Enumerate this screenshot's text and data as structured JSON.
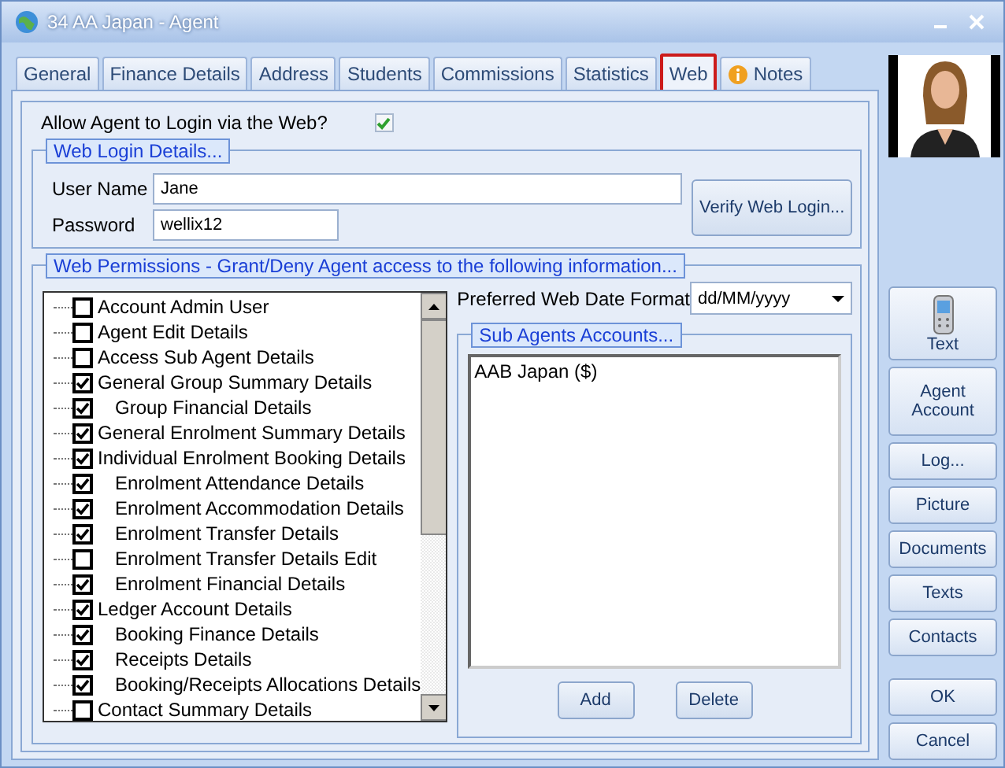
{
  "window": {
    "title": "34 AA Japan - Agent"
  },
  "tabs": [
    {
      "label": "General",
      "selected": false
    },
    {
      "label": "Finance Details",
      "selected": false
    },
    {
      "label": "Address",
      "selected": false
    },
    {
      "label": "Students",
      "selected": false
    },
    {
      "label": "Commissions",
      "selected": false
    },
    {
      "label": "Statistics",
      "selected": false
    },
    {
      "label": "Web",
      "selected": true
    },
    {
      "label": "Notes",
      "selected": false,
      "kind": "info"
    }
  ],
  "allow_web_login": {
    "label": "Allow Agent to Login via the Web?",
    "checked": true
  },
  "web_login": {
    "title": "Web Login Details...",
    "user_name_label": "User Name",
    "user_name": "Jane",
    "password_label": "Password",
    "password": "wellix12",
    "verify_button": "Verify Web Login..."
  },
  "permissions_title": "Web Permissions - Grant/Deny Agent access to the following information...",
  "permissions": [
    {
      "label": "Account Admin User",
      "checked": false
    },
    {
      "label": "Agent Edit Details",
      "checked": false
    },
    {
      "label": "Access Sub Agent Details",
      "checked": false
    },
    {
      "label": "General Group Summary Details",
      "checked": true,
      "children": [
        {
          "label": "Group Financial Details",
          "checked": true
        }
      ]
    },
    {
      "label": "General Enrolment Summary Details",
      "checked": true
    },
    {
      "label": "Individual Enrolment Booking Details",
      "checked": true,
      "children": [
        {
          "label": "Enrolment Attendance Details",
          "checked": true
        },
        {
          "label": "Enrolment Accommodation Details",
          "checked": true
        },
        {
          "label": "Enrolment Transfer Details",
          "checked": true
        },
        {
          "label": "Enrolment Transfer Details Edit",
          "checked": false
        },
        {
          "label": "Enrolment Financial Details",
          "checked": true
        }
      ]
    },
    {
      "label": "Ledger Account Details",
      "checked": true,
      "children": [
        {
          "label": "Booking Finance Details",
          "checked": true
        },
        {
          "label": "Receipts Details",
          "checked": true
        },
        {
          "label": "Booking/Receipts Allocations Details",
          "checked": true
        }
      ]
    },
    {
      "label": "Contact Summary Details",
      "checked": false
    }
  ],
  "date_format": {
    "label": "Preferred Web Date Format",
    "value": "dd/MM/yyyy"
  },
  "sub_agents": {
    "title": "Sub Agents Accounts...",
    "items": [
      "AAB Japan ($)"
    ],
    "buttons": [
      "Add",
      "Delete"
    ]
  },
  "side_buttons": [
    {
      "label": "Text",
      "kind": "phone"
    },
    {
      "label": "Agent Account",
      "kind": "plain"
    },
    {
      "label": "Log...",
      "kind": "plain"
    },
    {
      "label": "Picture",
      "kind": "plain"
    },
    {
      "label": "Documents",
      "kind": "plain"
    },
    {
      "label": "Texts",
      "kind": "plain"
    },
    {
      "label": "Contacts",
      "kind": "plain"
    }
  ],
  "dialog_buttons": [
    "OK",
    "Cancel"
  ]
}
